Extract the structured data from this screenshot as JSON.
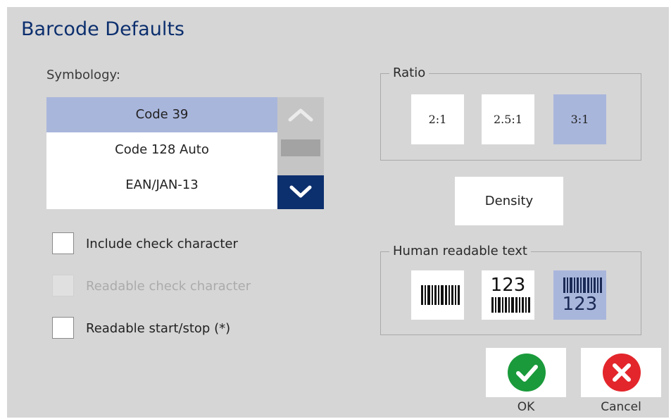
{
  "dialog": {
    "title": "Barcode Defaults"
  },
  "symbology": {
    "label": "Symbology:",
    "items": [
      "Code 39",
      "Code 128 Auto",
      "EAN/JAN-13"
    ],
    "selected": "Code 39"
  },
  "checkboxes": [
    {
      "label": "Include check character",
      "checked": false,
      "enabled": true
    },
    {
      "label": "Readable check character",
      "checked": false,
      "enabled": false
    },
    {
      "label": "Readable start/stop (*)",
      "checked": false,
      "enabled": true
    }
  ],
  "ratio": {
    "legend": "Ratio",
    "options": [
      "2:1",
      "2.5:1",
      "3:1"
    ],
    "selected": "3:1"
  },
  "density": {
    "label": "Density"
  },
  "human_readable": {
    "legend": "Human readable text",
    "options": [
      "none",
      "above",
      "below"
    ],
    "sample_text": "123",
    "selected": "below"
  },
  "actions": {
    "ok": "OK",
    "cancel": "Cancel"
  },
  "colors": {
    "title": "#0c2f6e",
    "selection": "#a9b6dc",
    "scroll_down": "#0c2f6e",
    "ok_green": "#1a9a3b",
    "cancel_red": "#e3262b"
  },
  "icons": {
    "scroll_up": "chevron-up-icon",
    "scroll_down": "chevron-down-icon",
    "ok": "check-circle-icon",
    "cancel": "x-circle-icon",
    "barcode": "barcode-icon"
  }
}
